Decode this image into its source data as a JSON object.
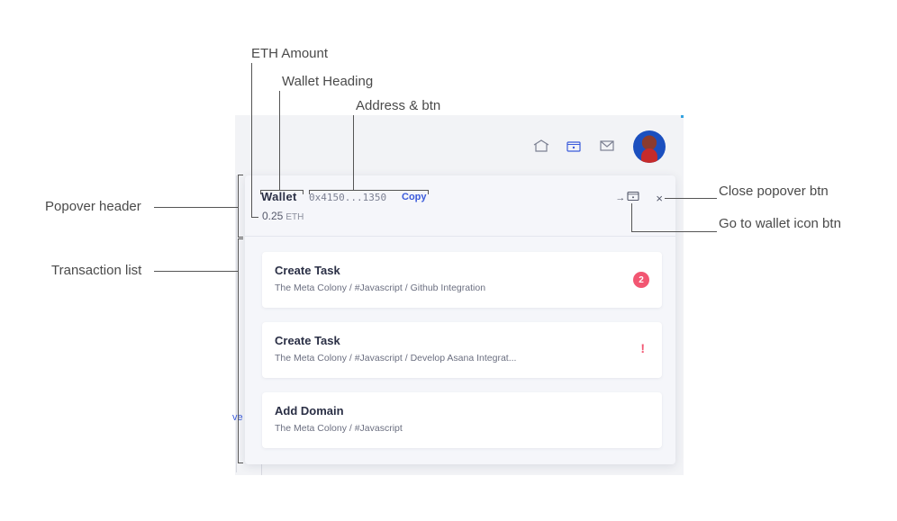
{
  "annotations": {
    "eth_amount": "ETH Amount",
    "wallet_heading": "Wallet Heading",
    "address_btn": "Address & btn",
    "popover_header": "Popover header",
    "transaction_list": "Transaction list",
    "close_popover_btn": "Close popover btn",
    "go_to_wallet_btn": "Go to wallet icon btn"
  },
  "topbar": {
    "icons": [
      "home-icon",
      "wallet-icon",
      "inbox-icon"
    ],
    "active_icon": "wallet-icon",
    "accent_color": "#3b5bdb"
  },
  "sidebar": {
    "partial_link": "ve"
  },
  "popover": {
    "heading": "Wallet",
    "address": "0x4150...1350",
    "copy_label": "Copy",
    "eth_value": "0.25",
    "eth_unit": "ETH",
    "actions": {
      "go_to_wallet_arrow": "→",
      "close_glyph": "×"
    },
    "transactions": [
      {
        "title": "Create Task",
        "path": "The Meta Colony / #Javascript / Github Integration",
        "badge": "2"
      },
      {
        "title": "Create Task",
        "path": "The Meta Colony / #Javascript / Develop Asana Integrat...",
        "alert": "!"
      },
      {
        "title": "Add Domain",
        "path": "The Meta Colony / #Javascript"
      }
    ],
    "badge_color": "#f25672"
  }
}
